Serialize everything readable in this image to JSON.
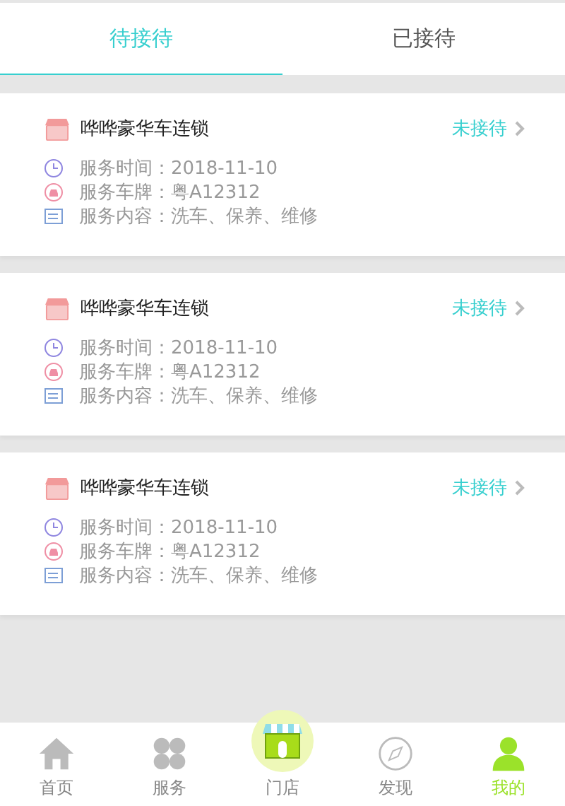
{
  "tabs": [
    {
      "label": "待接待",
      "selected": true
    },
    {
      "label": "已接待",
      "selected": false
    }
  ],
  "orders": [
    {
      "shop": "哗哗豪华车连锁",
      "status": "未接待",
      "lines": [
        {
          "kind": "time",
          "text": "服务时间：2018-11-10"
        },
        {
          "kind": "plate",
          "text": "服务车牌：粤A12312"
        },
        {
          "kind": "content",
          "text": "服务内容：洗车、保养、维修"
        }
      ]
    },
    {
      "shop": "哗哗豪华车连锁",
      "status": "未接待",
      "lines": [
        {
          "kind": "time",
          "text": "服务时间：2018-11-10"
        },
        {
          "kind": "plate",
          "text": "服务车牌：粤A12312"
        },
        {
          "kind": "content",
          "text": "服务内容：洗车、保养、维修"
        }
      ]
    },
    {
      "shop": "哗哗豪华车连锁",
      "status": "未接待",
      "lines": [
        {
          "kind": "time",
          "text": "服务时间：2018-11-10"
        },
        {
          "kind": "plate",
          "text": "服务车牌：粤A12312"
        },
        {
          "kind": "content",
          "text": "服务内容：洗车、保养、维修"
        }
      ]
    }
  ],
  "nav": [
    {
      "kind": "home",
      "label": "首页",
      "selected": false
    },
    {
      "kind": "service",
      "label": "服务",
      "selected": false
    },
    {
      "kind": "store",
      "label": "门店",
      "selected": false
    },
    {
      "kind": "discover",
      "label": "发现",
      "selected": false
    },
    {
      "kind": "me",
      "label": "我的",
      "selected": true
    }
  ]
}
